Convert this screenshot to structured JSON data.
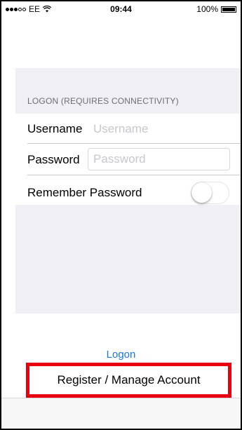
{
  "status_bar": {
    "carrier": "EE",
    "time": "09:44",
    "battery": "100%"
  },
  "logon_section": {
    "header": "LOGON (REQUIRES CONNECTIVITY)",
    "username_label": "Username",
    "username_placeholder": "Username",
    "password_label": "Password",
    "password_placeholder": "Password",
    "remember_label": "Remember Password",
    "remember_on": false
  },
  "actions": {
    "logon_label": "Logon",
    "register_label": "Register / Manage Account"
  },
  "colors": {
    "link": "#1a75e6",
    "highlight_border": "#e8000e",
    "group_background": "#efeff4"
  }
}
